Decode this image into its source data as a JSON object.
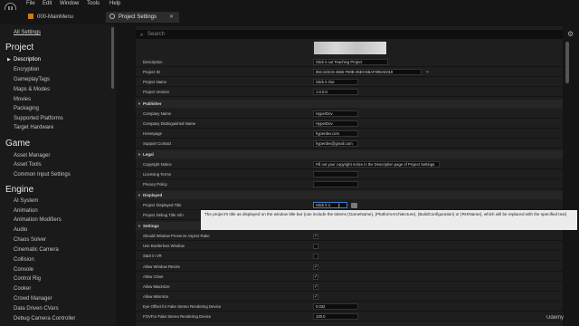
{
  "menubar": {
    "logo": "U",
    "items": [
      "File",
      "Edit",
      "Window",
      "Tools",
      "Help"
    ]
  },
  "tabs": [
    {
      "label": "000-MainMenu",
      "active": false
    },
    {
      "label": "Project Settings",
      "active": true
    }
  ],
  "sidebar": {
    "all_settings": "All Settings",
    "categories": [
      {
        "title": "Project",
        "items": [
          "Description",
          "Encryption",
          "GameplayTags",
          "Maps & Modes",
          "Movies",
          "Packaging",
          "Supported Platforms",
          "Target Hardware"
        ]
      },
      {
        "title": "Game",
        "items": [
          "Asset Manager",
          "Asset Tools",
          "Common Input Settings"
        ]
      },
      {
        "title": "Engine",
        "items": [
          "AI System",
          "Animation",
          "Animation Modifiers",
          "Audio",
          "Chaos Solver",
          "Cinematic Camera",
          "Collision",
          "Console",
          "Control Rig",
          "Cooker",
          "Crowd Manager",
          "Data Driven CVars",
          "Debug Camera Controller"
        ]
      }
    ],
    "selected": "Description"
  },
  "search": {
    "placeholder": "Search"
  },
  "details": {
    "top_rows": [
      {
        "label": "Description",
        "value": "Stick it out Teaching Project"
      },
      {
        "label": "Project ID",
        "value": "85C44SC6-4565-F60B-35E0-5BAF095AE019"
      },
      {
        "label": "Project Name",
        "value": "Stick It Out"
      },
      {
        "label": "Project Version",
        "value": "1.0.0.0"
      }
    ],
    "publisher": {
      "title": "Publisher",
      "rows": [
        {
          "label": "Company Name",
          "value": "HyperDev"
        },
        {
          "label": "Company Distinguished Name",
          "value": "HyperDev"
        },
        {
          "label": "Homepage",
          "value": "hyperdev.com"
        },
        {
          "label": "Support Contact",
          "value": "hyperdev@gmail.com"
        }
      ]
    },
    "legal": {
      "title": "Legal",
      "rows": [
        {
          "label": "Copyright Notice",
          "value": "Fill out your copyright notice in the Description page of Project Settings."
        },
        {
          "label": "Licensing Terms",
          "value": ""
        },
        {
          "label": "Privacy Policy",
          "value": ""
        }
      ]
    },
    "displayed": {
      "title": "Displayed",
      "rows": [
        {
          "label": "Project Displayed Title",
          "value": "Stick It o"
        },
        {
          "label": "Project Debug Title Info",
          "value": ""
        }
      ]
    },
    "settings": {
      "title": "Settings",
      "rows": [
        {
          "label": "Should Window Preserve Aspect Ratio",
          "checked": true
        },
        {
          "label": "Use Borderless Window",
          "checked": false
        },
        {
          "label": "Start in VR",
          "checked": false
        },
        {
          "label": "Allow Window Resize",
          "checked": true
        },
        {
          "label": "Allow Close",
          "checked": true
        },
        {
          "label": "Allow Maximize",
          "checked": true
        },
        {
          "label": "Allow Minimize",
          "checked": true
        },
        {
          "label": "Eye Offset for Fake Stereo Rendering Device",
          "value": "0.032"
        },
        {
          "label": "FOVFor Fake Stereo Rendering Device",
          "value": "100.0"
        }
      ]
    }
  },
  "tooltip": "The project's title as displayed on the window title bar (can include the tokens {GameName}, {PlatformArchitecture}, {BuildConfiguration} or {RHIName}, which will be replaced with the specified text)",
  "watermark": "Udemy",
  "colors": {
    "background": "#151515",
    "panel": "#1e1e1e",
    "section": "#262626",
    "tooltip_bg": "#ececec"
  }
}
